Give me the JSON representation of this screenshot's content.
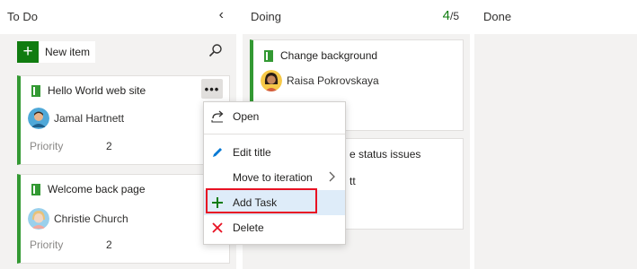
{
  "columns": {
    "todo": {
      "title": "To Do",
      "collapse_glyph": "‹",
      "new_item_label": "New item"
    },
    "doing": {
      "title": "Doing",
      "wip_current": "4",
      "wip_limit": "/5"
    },
    "done": {
      "title": "Done"
    }
  },
  "cards": {
    "hello": {
      "title": "Hello World web site",
      "assignee": "Jamal Hartnett",
      "priority_label": "Priority",
      "priority_value": "2"
    },
    "welcome": {
      "title": "Welcome back page",
      "assignee": "Christie Church",
      "priority_label": "Priority",
      "priority_value": "2"
    },
    "change_bg": {
      "title": "Change background",
      "assignee": "Raisa Pokrovskaya"
    },
    "status": {
      "title_fragment": "e status issues",
      "assignee_fragment": "tt"
    }
  },
  "more_button": {
    "label": "•••"
  },
  "context_menu": {
    "items": [
      {
        "label": "Open",
        "icon": "share-arrow-icon"
      },
      {
        "label": "Edit title",
        "icon": "pencil-icon"
      },
      {
        "label": "Move to iteration",
        "icon": "chevron-right-icon"
      },
      {
        "label": "Add Task",
        "icon": "plus-icon"
      },
      {
        "label": "Delete",
        "icon": "x-icon"
      }
    ]
  },
  "colors": {
    "green_accent": "#339933",
    "wip_green": "#107c10",
    "highlight": "#deecf9",
    "callout_red": "#e81123",
    "delete_red": "#e81123",
    "edit_blue": "#0078d4"
  }
}
